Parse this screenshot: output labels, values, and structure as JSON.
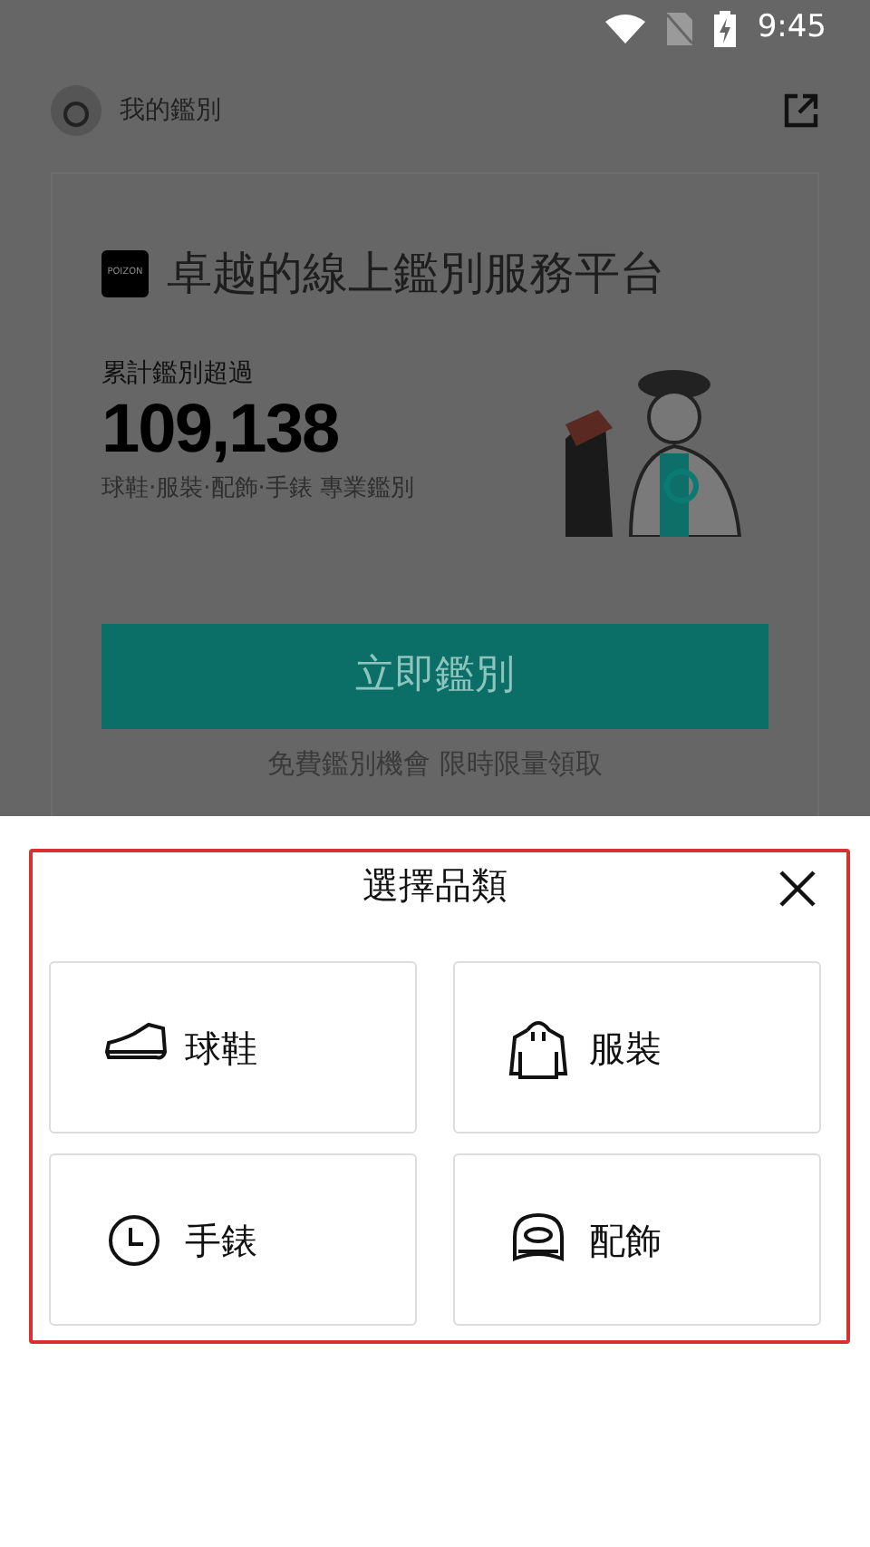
{
  "status_bar": {
    "time": "9:45"
  },
  "header": {
    "title": "我的鑑別"
  },
  "card": {
    "logo_text": "POIZON",
    "title": "卓越的線上鑑別服務平台",
    "count_label": "累計鑑別超過",
    "count": "109,138",
    "subtitle": "球鞋·服裝·配飾·手錶 專業鑑別",
    "button": "立即鑑別",
    "note": "免費鑑別機會 限時限量領取"
  },
  "sheet": {
    "title": "選擇品類",
    "categories": [
      {
        "kind": "shoe",
        "label": "球鞋"
      },
      {
        "kind": "hoodie",
        "label": "服裝"
      },
      {
        "kind": "watch",
        "label": "手錶"
      },
      {
        "kind": "cap",
        "label": "配飾"
      }
    ]
  }
}
